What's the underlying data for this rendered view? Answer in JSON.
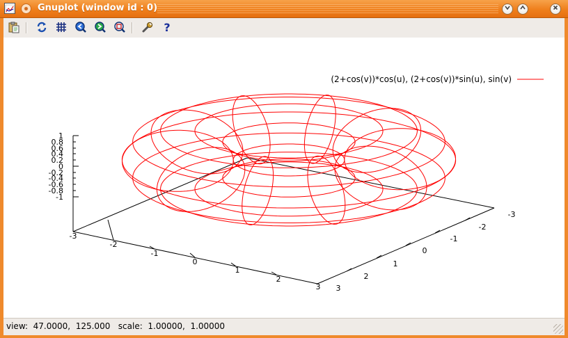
{
  "window": {
    "title": "Gnuplot (window id : 0)",
    "minimize_icon": "chevron-down-icon",
    "maximize_icon": "chevron-up-icon",
    "close_icon": "close-icon"
  },
  "toolbar": {
    "buttons": [
      {
        "icon": "copy-to-clipboard-icon"
      },
      {
        "icon": "replot-icon"
      },
      {
        "icon": "grid-icon"
      },
      {
        "icon": "zoom-previous-icon"
      },
      {
        "icon": "zoom-next-icon"
      },
      {
        "icon": "autoscale-icon"
      },
      {
        "icon": "settings-wrench-icon"
      },
      {
        "icon": "help-icon"
      }
    ]
  },
  "plot": {
    "legend_label": "(2+cos(v))*cos(u), (2+cos(v))*sin(u), sin(v)",
    "line_color": "#ff0000",
    "z_ticks": [
      "1",
      "0.8",
      "0.6",
      "0.4",
      "0.2",
      "0",
      "-0.2",
      "-0.4",
      "-0.6",
      "-0.8",
      "-1"
    ],
    "x_ticks": [
      "-3",
      "-2",
      "-1",
      "0",
      "1",
      "2",
      "3"
    ],
    "y_ticks": [
      "3",
      "2",
      "1",
      "0",
      "-1",
      "-2",
      "-3"
    ]
  },
  "status": {
    "text": "view:  47.0000,  125.000   scale:  1.00000,  1.00000"
  }
}
